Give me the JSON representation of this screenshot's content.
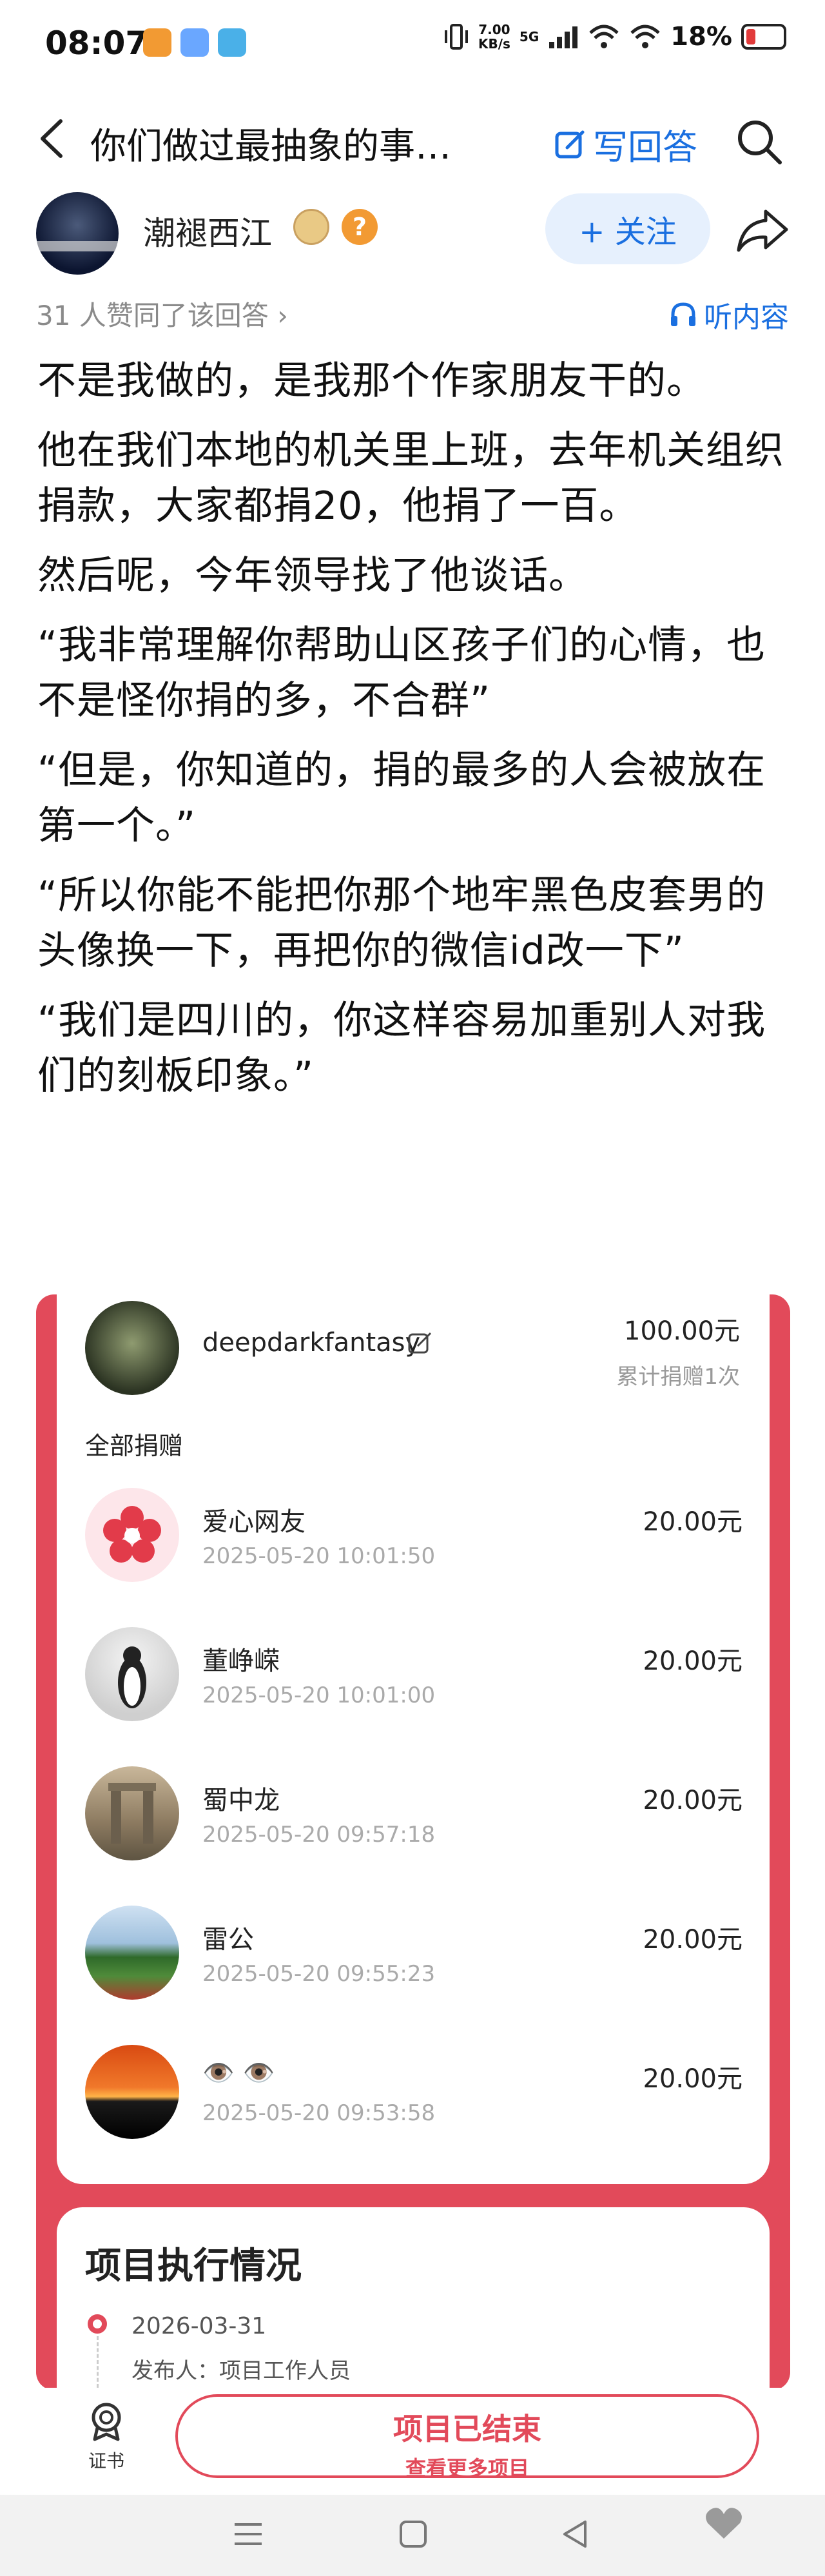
{
  "status_bar": {
    "time": "08:07",
    "net_speed_value": "7.00",
    "net_speed_unit": "KB/s",
    "signal_label": "5G",
    "battery_percent": "18%"
  },
  "header": {
    "question_title": "你们做过最抽象的事…",
    "write_answer_label": "写回答"
  },
  "author": {
    "name": "潮褪西江",
    "follow_label": "+ 关注",
    "help_badge": "?"
  },
  "meta": {
    "likes_text": "31 人赞同了该回答 ›",
    "listen_label": "听内容"
  },
  "answer": {
    "paragraphs": [
      "不是我做的，是我那个作家朋友干的。",
      "他在我们本地的机关里上班，去年机关组织捐款，大家都捐20，他捐了一百。",
      "然后呢，今年领导找了他谈话。",
      "“我非常理解你帮助山区孩子们的心情，也不是怪你捐的多，不合群”",
      "“但是，你知道的，捐的最多的人会被放在第一个。”",
      "“所以你能不能把你那个地牢黑色皮套男的头像换一下，再把你的微信id改一下”",
      "“我们是四川的，你这样容易加重别人对我们的刻板印象。”"
    ]
  },
  "donation": {
    "top_donor": {
      "name": "deepdarkfantasy",
      "amount": "100.00元",
      "count_text": "累计捐赠1次"
    },
    "all_title": "全部捐赠",
    "items": [
      {
        "name": "爱心网友",
        "time": "2025-05-20 10:01:50",
        "amount": "20.00元"
      },
      {
        "name": "董峥嵘",
        "time": "2025-05-20 10:01:00",
        "amount": "20.00元"
      },
      {
        "name": "蜀中龙",
        "time": "2025-05-20 09:57:18",
        "amount": "20.00元"
      },
      {
        "name": "雷公",
        "time": "2025-05-20 09:55:23",
        "amount": "20.00元"
      },
      {
        "name": "👁️ 👁️",
        "time": "2025-05-20 09:53:58",
        "amount": "20.00元"
      }
    ]
  },
  "execution": {
    "title": "项目执行情况",
    "date": "2026-03-31",
    "publisher": "发布人：项目工作人员"
  },
  "bottom_bar": {
    "cert_label": "证书",
    "ended_main": "项目已结束",
    "ended_sub": "查看更多项目"
  },
  "colors": {
    "accent_blue": "#1a6fe0",
    "donation_red": "#e24a5a",
    "battery_red": "#e23b3b"
  },
  "icons": [
    "back-arrow-icon",
    "edit-square-icon",
    "search-icon",
    "share-arrow-icon",
    "headphones-icon",
    "edit-icon",
    "certificate-icon",
    "menu-icon",
    "home-square-icon",
    "back-triangle-icon",
    "heart-icon"
  ]
}
